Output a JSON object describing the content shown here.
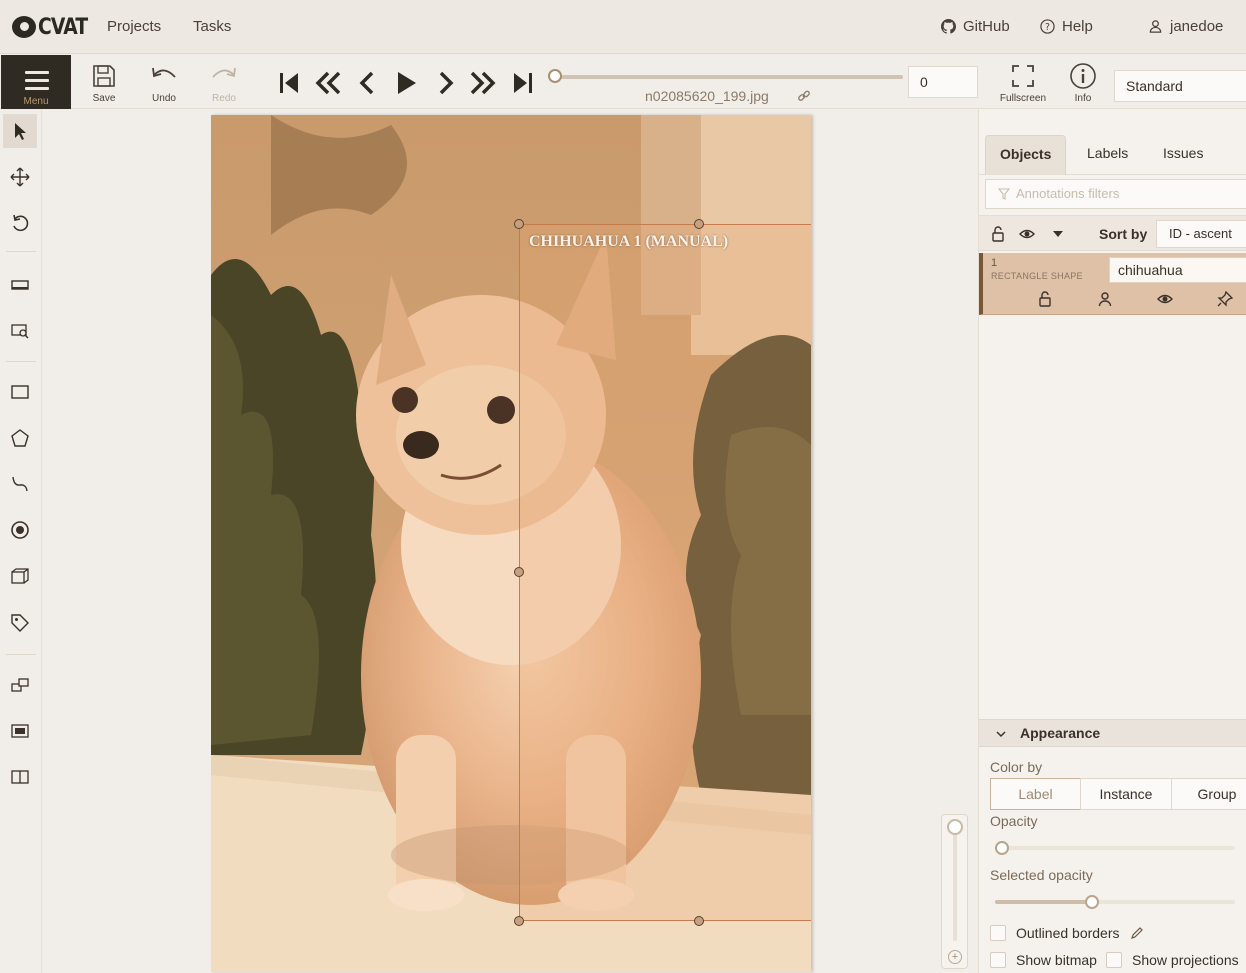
{
  "header": {
    "logo_text": "CVAT",
    "nav": [
      {
        "label": "Projects"
      },
      {
        "label": "Tasks"
      }
    ],
    "github_label": "GitHub",
    "help_label": "Help",
    "user_label": "janedoe"
  },
  "toolbar": {
    "menu_label": "Menu",
    "save_label": "Save",
    "undo_label": "Undo",
    "redo_label": "Redo",
    "filename": "n02085620_199.jpg",
    "frame_number": "0",
    "fullscreen_label": "Fullscreen",
    "info_label": "Info",
    "workspace": "Standard",
    "frame_progress": 0
  },
  "controls": [
    "cursor-icon",
    "move-icon",
    "rotate-icon",
    "fit-icon",
    "zoom-region-icon",
    "rectangle-icon",
    "polygon-icon",
    "polyline-icon",
    "points-icon",
    "cuboid-icon",
    "tag-icon",
    "merge-icon",
    "group-icon",
    "split-icon"
  ],
  "canvas": {
    "bbox_label": "CHIHUAHUA 1 (MANUAL)"
  },
  "sidebar": {
    "tabs": [
      {
        "label": "Objects"
      },
      {
        "label": "Labels"
      },
      {
        "label": "Issues"
      }
    ],
    "filter_placeholder": "Annotations filters",
    "sort_label": "Sort by",
    "sort_value": "ID - ascent",
    "object": {
      "id": "1",
      "type": "RECTANGLE SHAPE",
      "label": "chihuahua"
    },
    "appearance": {
      "title": "Appearance",
      "color_by_label": "Color by",
      "color_by_options": [
        {
          "label": "Label"
        },
        {
          "label": "Instance"
        },
        {
          "label": "Group"
        }
      ],
      "opacity_label": "Opacity",
      "opacity_value": 0,
      "selected_opacity_label": "Selected opacity",
      "selected_opacity_value": 0.4,
      "outlined_borders_label": "Outlined borders",
      "show_bitmap_label": "Show bitmap",
      "show_projections_label": "Show projections"
    }
  }
}
